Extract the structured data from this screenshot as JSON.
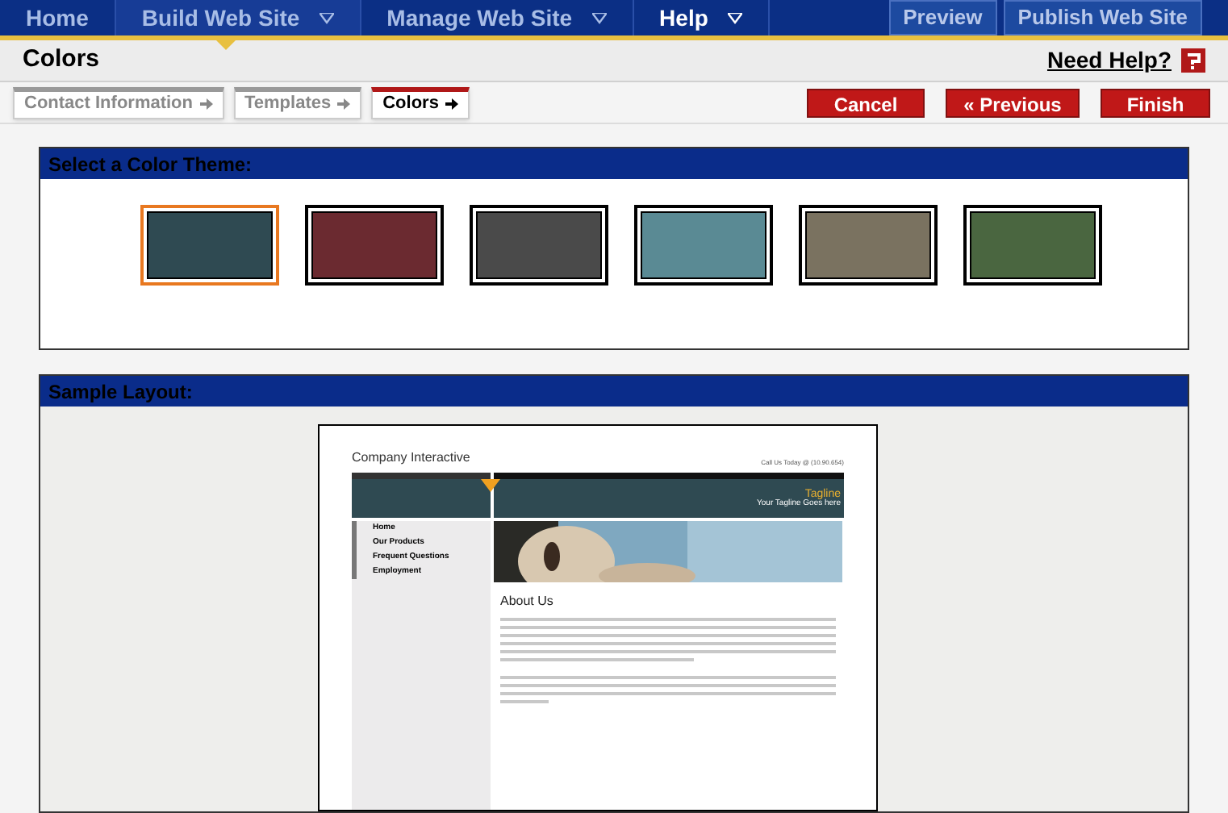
{
  "nav": {
    "items": [
      {
        "label": "Home",
        "selected": false,
        "dropdown": false
      },
      {
        "label": "Build Web Site",
        "selected": true,
        "dropdown": true
      },
      {
        "label": "Manage Web Site",
        "selected": false,
        "dropdown": true
      },
      {
        "label": "Help",
        "selected": false,
        "dropdown": true
      }
    ],
    "buttons": [
      "Preview",
      "Publish Web Site"
    ]
  },
  "header": {
    "title": "Colors",
    "help": "Need Help?"
  },
  "steps": [
    {
      "label": "Contact Information",
      "selected": false
    },
    {
      "label": "Templates",
      "selected": false
    },
    {
      "label": "Colors",
      "selected": true
    }
  ],
  "actions": [
    "Cancel",
    "« Previous",
    "Finish"
  ],
  "theme_panel": {
    "title": "Select a Color Theme:",
    "swatches": [
      {
        "color": "#2f4a52",
        "selected": true
      },
      {
        "color": "#6b2a30",
        "selected": false
      },
      {
        "color": "#4a4a4a",
        "selected": false
      },
      {
        "color": "#5a8a94",
        "selected": false
      },
      {
        "color": "#7a7260",
        "selected": false
      },
      {
        "color": "#4a6640",
        "selected": false
      }
    ]
  },
  "sample_panel": {
    "title": "Sample Layout:",
    "preview": {
      "company": "Company Interactive",
      "phone": "Call Us Today @ (10.90.654)",
      "tagline": "Tagline",
      "tagline_sub": "Your Tagline Goes here",
      "menu": [
        "Home",
        "Our Products",
        "Frequent Questions",
        "Employment"
      ],
      "heading": "About Us"
    }
  }
}
